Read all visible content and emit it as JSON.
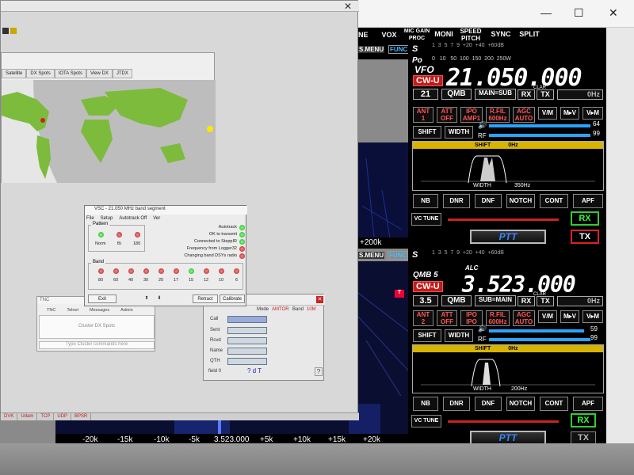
{
  "radio_top_menu": {
    "ne": "NE",
    "vox": "VOX",
    "mic_gain_proc": "MIC GAIN\nPROC",
    "moni": "MONI",
    "speed_pitch": "SPEED\nPITCH",
    "sync": "SYNC",
    "split": "SPLIT"
  },
  "radio1": {
    "menu_left": "S.MENU",
    "func": "FUNC",
    "s_label": "S",
    "s_scale": "1  3  5  7  9  +20  +40  +60dB",
    "po_label": "Po",
    "po_scale": "0   10   50  100  150  200  250W",
    "vfo": "VFO",
    "mode": "CW-U",
    "frequency": "21.050.000",
    "band": "21",
    "qmb": "QMB",
    "main_sub": "MAIN=SUB",
    "rx": "RX",
    "tx": "TX",
    "clar": "CLAR",
    "clar_value": "0Hz",
    "ant": "ANT\n1",
    "att": "ATT\nOFF",
    "ipo": "IPO\nAMP1",
    "rfil": "R.FIL\n600Hz",
    "agc": "AGC\nAUTO",
    "vm": "V/M",
    "mv": "M▸V",
    "vtom": "V▸M",
    "shift": "SHIFT",
    "width": "WIDTH",
    "af_value": "64",
    "rf_label": "RF",
    "rf_value": "99",
    "scope_shift": "SHIFT",
    "scope_hz": "0Hz",
    "scope_width_label": "WIDTH",
    "scope_width_value": "350Hz",
    "nb": "NB",
    "dnr": "DNR",
    "dnf": "DNF",
    "notch": "NOTCH",
    "cont": "CONT",
    "apf": "APF",
    "vc_tune": "VC TUNE",
    "rx_btn": "RX",
    "tx_btn": "TX",
    "ptt": "PTT",
    "axis_label": "+200k"
  },
  "radio2": {
    "menu_left": "S.MENU",
    "func": "FUNC",
    "s_label": "S",
    "s_scale": "1  3  5  7  9  +20  +40  +60dB",
    "alc": "ALC",
    "qmb_label": "QMB 5",
    "mode": "CW-U",
    "frequency": "3.523.000",
    "band": "3.5",
    "qmb": "QMB",
    "sub_main": "SUB=MAIN",
    "rx": "RX",
    "tx": "TX",
    "clar": "CLAR",
    "clar_value": "0Hz",
    "ant": "ANT\n2",
    "att": "ATT\nOFF",
    "ipo": "IPO\nIPO",
    "rfil": "R.FIL\n600Hz",
    "agc": "AGC\nAUTO",
    "vm": "V/M",
    "mv": "M▸V",
    "vtom": "V▸M",
    "shift": "SHIFT",
    "width": "WIDTH",
    "af_value": "59",
    "rf_label": "RF",
    "rf_value": "99",
    "scope_shift": "SHIFT",
    "scope_hz": "0Hz",
    "scope_width_label": "WIDTH",
    "scope_width_value": "200Hz",
    "nb": "NB",
    "dnr": "DNR",
    "dnf": "DNF",
    "notch": "NOTCH",
    "cont": "CONT",
    "apf": "APF",
    "vc_tune": "VC TUNE",
    "rx_btn": "RX",
    "tx_btn": "TX",
    "ptt": "PTT"
  },
  "freq_axis": [
    "-20k",
    "-15k",
    "-10k",
    "-5k",
    "3.523.000",
    "+5k",
    "+10k",
    "+15k",
    "+20k"
  ],
  "marker_t": "T",
  "map_window": {
    "tabs": [
      "Satellite",
      "DX Spots",
      "IOTA Spots",
      "View DX",
      "JTDX"
    ]
  },
  "vsc": {
    "title": "VSC - 21.050 MHz band segment",
    "menu": [
      "File",
      "Setup",
      "Autotrack Off",
      "Ver"
    ],
    "pattern_title": "Pattern",
    "pattern_labels": [
      "Norm",
      "Bi",
      "180"
    ],
    "status": [
      "Autotrack",
      "OK to transmit",
      "Connected to SteppIR",
      "Frequency from Logger32",
      "Changing band DSYs radio"
    ],
    "band_title": "Band",
    "bands": [
      "80",
      "60",
      "40",
      "30",
      "20",
      "17",
      "15",
      "12",
      "10",
      "6"
    ],
    "exit": "Exit",
    "up": "⬆",
    "down": "⬇",
    "retract": "Retract",
    "calibrate": "Calibrate"
  },
  "cluster": {
    "title": "TNC",
    "columns": [
      "TNC",
      "Telnet",
      "Messages",
      "Admin"
    ],
    "center_text": "Cluster DX Spots",
    "input_placeholder": "Type Cluster commands here"
  },
  "entry": {
    "mode_label": "Mode",
    "mode_value": "AMTOR",
    "band_label": "Band",
    "band_value": "10M",
    "fields": [
      "Call",
      "Sent",
      "Rcvd",
      "Name",
      "QTH"
    ],
    "field_count": "field 0",
    "help": "? d T",
    "help_btn": "?"
  },
  "statusbar": [
    "DVK",
    "Udam",
    "TCP",
    "UDP",
    "BPSR"
  ],
  "window_controls": {
    "min": "—",
    "max": "☐",
    "close": "✕"
  },
  "logger_close": "✕"
}
